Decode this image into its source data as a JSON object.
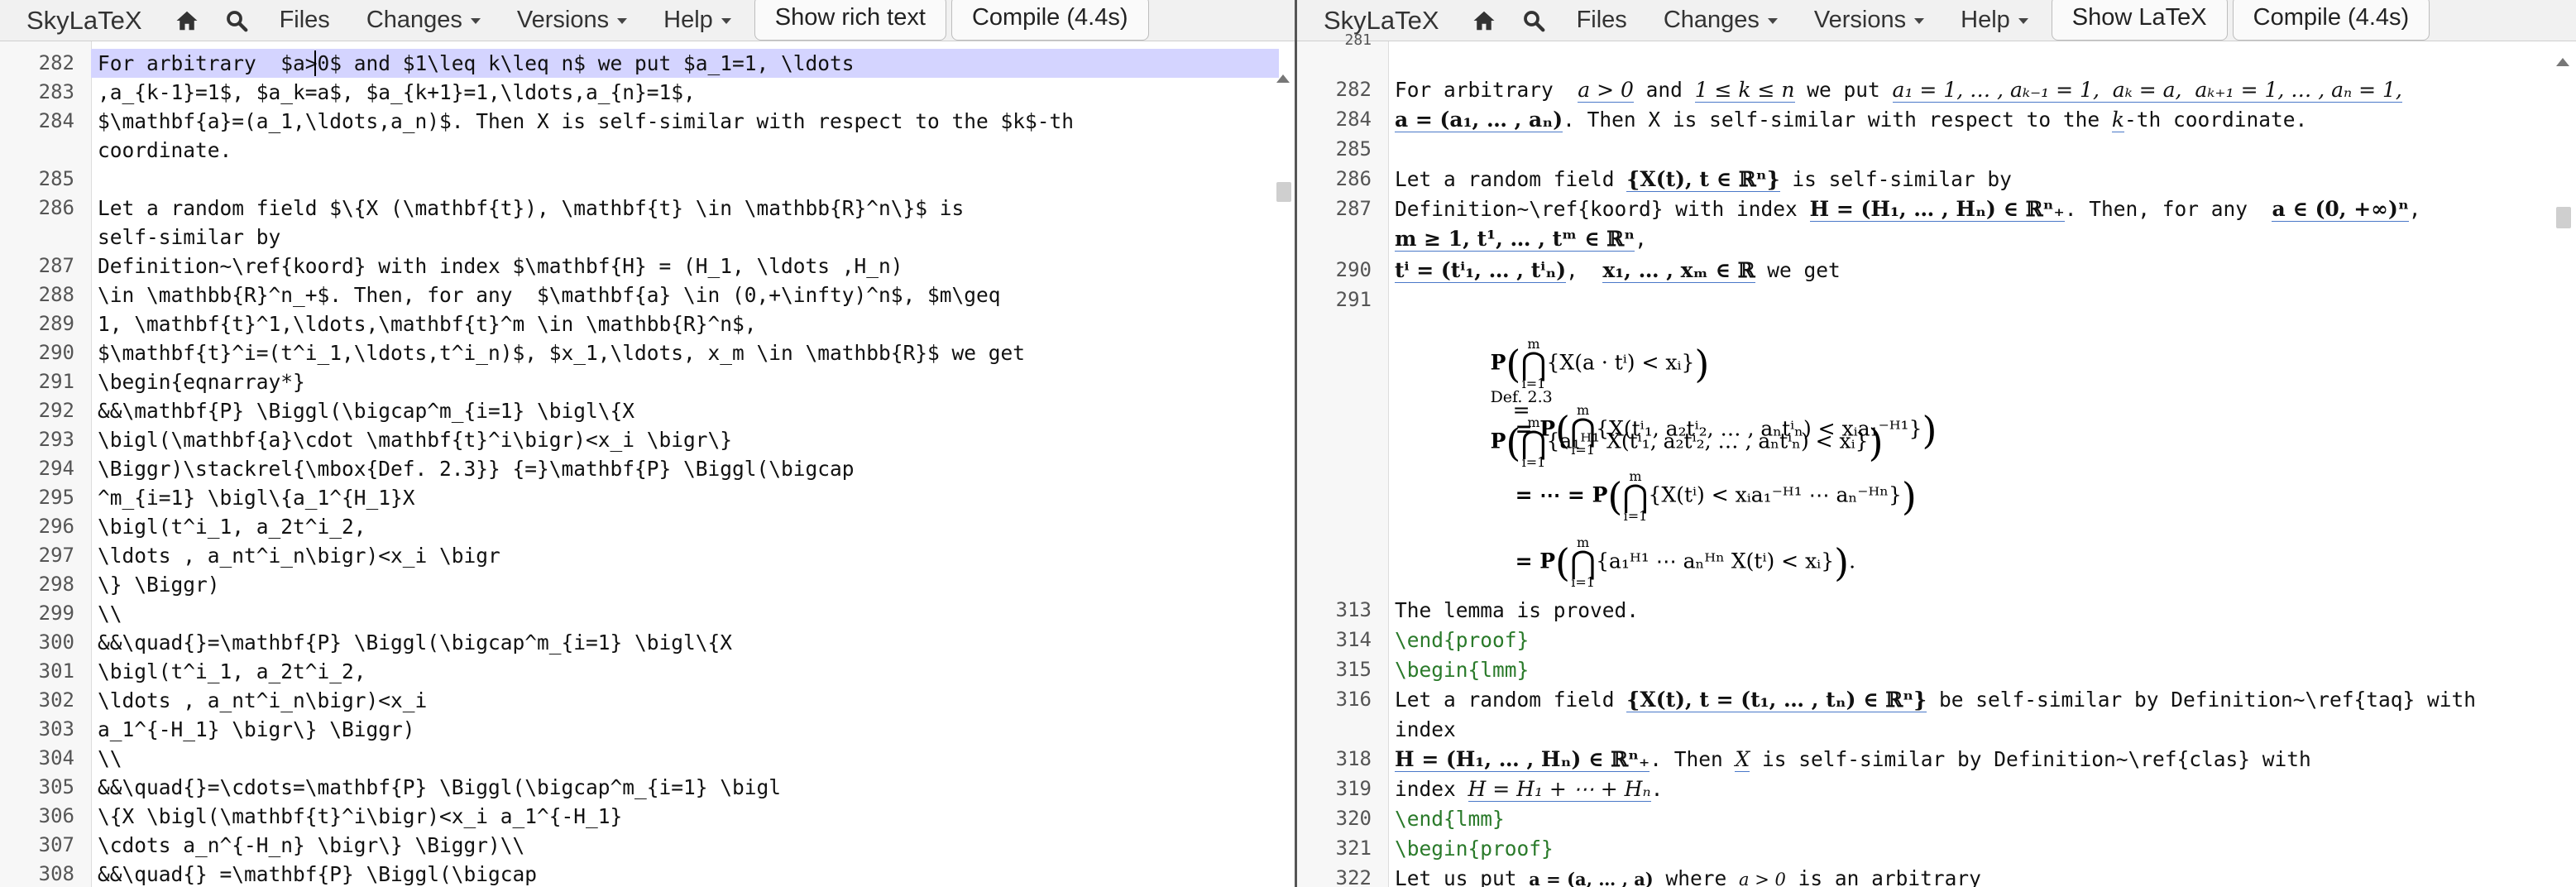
{
  "left": {
    "brand": "SkyLaTeX",
    "menu": {
      "files": "Files",
      "changes": "Changes",
      "versions": "Versions",
      "help": "Help"
    },
    "buttons": {
      "toggle": "Show rich text",
      "compile": "Compile (4.4s)"
    },
    "lines": [
      {
        "n": "282",
        "t": "For arbitrary  $a>0$ and $1\\leq k\\leq n$ we put $a_1=1, \\ldots"
      },
      {
        "n": "283",
        "t": ",a_{k-1}=1$, $a_k=a$, $a_{k+1}=1,\\ldots,a_{n}=1$,"
      },
      {
        "n": "284",
        "t": "$\\mathbf{a}=(a_1,\\ldots,a_n)$. Then X is self-similar with respect to the $k$-th"
      },
      {
        "n": "",
        "t": "coordinate."
      },
      {
        "n": "285",
        "t": ""
      },
      {
        "n": "286",
        "t": "Let a random field $\\{X (\\mathbf{t}), \\mathbf{t} \\in \\mathbb{R}^n\\}$ is"
      },
      {
        "n": "",
        "t": "self-similar by"
      },
      {
        "n": "287",
        "t": "Definition~\\ref{koord} with index $\\mathbf{H} = (H_1, \\ldots ,H_n)"
      },
      {
        "n": "288",
        "t": "\\in \\mathbb{R}^n_+$. Then, for any  $\\mathbf{a} \\in (0,+\\infty)^n$, $m\\geq"
      },
      {
        "n": "289",
        "t": "1, \\mathbf{t}^1,\\ldots,\\mathbf{t}^m \\in \\mathbb{R}^n$,"
      },
      {
        "n": "290",
        "t": "$\\mathbf{t}^i=(t^i_1,\\ldots,t^i_n)$, $x_1,\\ldots, x_m \\in \\mathbb{R}$ we get"
      },
      {
        "n": "291",
        "t": "\\begin{eqnarray*}"
      },
      {
        "n": "292",
        "t": "&&\\mathbf{P} \\Biggl(\\bigcap^m_{i=1} \\bigl\\{X"
      },
      {
        "n": "293",
        "t": "\\bigl(\\mathbf{a}\\cdot \\mathbf{t}^i\\bigr)<x_i \\bigr\\}"
      },
      {
        "n": "294",
        "t": "\\Biggr)\\stackrel{\\mbox{Def. 2.3}} {=}\\mathbf{P} \\Biggl(\\bigcap"
      },
      {
        "n": "295",
        "t": "^m_{i=1} \\bigl\\{a_1^{H_1}X"
      },
      {
        "n": "296",
        "t": "\\bigl(t^i_1, a_2t^i_2,"
      },
      {
        "n": "297",
        "t": "\\ldots , a_nt^i_n\\bigr)<x_i \\bigr"
      },
      {
        "n": "298",
        "t": "\\} \\Biggr)"
      },
      {
        "n": "299",
        "t": "\\\\"
      },
      {
        "n": "300",
        "t": "&&\\quad{}=\\mathbf{P} \\Biggl(\\bigcap^m_{i=1} \\bigl\\{X"
      },
      {
        "n": "301",
        "t": "\\bigl(t^i_1, a_2t^i_2,"
      },
      {
        "n": "302",
        "t": "\\ldots , a_nt^i_n\\bigr)<x_i"
      },
      {
        "n": "303",
        "t": "a_1^{-H_1} \\bigr\\} \\Biggr)"
      },
      {
        "n": "304",
        "t": "\\\\"
      },
      {
        "n": "305",
        "t": "&&\\quad{}=\\cdots=\\mathbf{P} \\Biggl(\\bigcap^m_{i=1} \\bigl"
      },
      {
        "n": "306",
        "t": "\\{X \\bigl(\\mathbf{t}^i\\bigr)<x_i a_1^{-H_1}"
      },
      {
        "n": "307",
        "t": "\\cdots a_n^{-H_n} \\bigr\\} \\Biggr)\\\\"
      },
      {
        "n": "308",
        "t": "&&\\quad{} =\\mathbf{P} \\Biggl(\\bigcap"
      }
    ]
  },
  "right": {
    "brand": "SkyLaTeX",
    "menu": {
      "files": "Files",
      "changes": "Changes",
      "versions": "Versions",
      "help": "Help"
    },
    "buttons": {
      "toggle": "Show LaTeX",
      "compile": "Compile (4.4s)"
    },
    "numbers": [
      "281",
      "282",
      "284",
      "285",
      "286",
      "287",
      "290",
      "291",
      "313",
      "314",
      "315",
      "316",
      "318",
      "319",
      "320",
      "321",
      "322"
    ],
    "text": {
      "l282_a": "For arbitrary  ",
      "l282_m1": "a > 0",
      "l282_b": " and ",
      "l282_m2": "1 ≤ k ≤ n",
      "l282_c": " we put ",
      "l282_m3": "a₁ = 1, … , aₖ₋₁ = 1,  aₖ = a,  aₖ₊₁ = 1, … , aₙ = 1,",
      "l284_m": "a = (a₁, … , aₙ)",
      "l284_b": ". Then X is self-similar with respect to the ",
      "l284_k": "k",
      "l284_c": "-th coordinate.",
      "l286_a": "Let a random field ",
      "l286_m": "{X(t), t ∈ ℝⁿ}",
      "l286_b": " is self-similar by",
      "l287_a": "Definition~\\ref{koord} with index ",
      "l287_m": "H = (H₁, … , Hₙ) ∈ ℝⁿ₊",
      "l287_b": ". Then, for any  ",
      "l287_m2": "a ∈ (0, +∞)ⁿ",
      "l287_c": ",",
      "l288_m": "m ≥ 1, t¹, … , tᵐ ∈ ℝⁿ",
      "l288_c": ",",
      "l290_m": "tⁱ = (tⁱ₁, … , tⁱₙ)",
      "l290_b": ",  ",
      "l290_m2": "x₁, … , xₘ ∈ ℝ",
      "l290_c": " we get",
      "eq1_a": "P",
      "eq1_b": "{X(a · tⁱ) < xᵢ}",
      "eq1_def": "Def. 2.3",
      "eq1_c": "P",
      "eq1_d": "{a₁ᴴ¹ X(tⁱ₁, a₂tⁱ₂, … , aₙtⁱₙ) < xᵢ}",
      "eq2": "= P",
      "eq2_b": "{X(tⁱ₁, a₂tⁱ₂, … , aₙtⁱₙ) < xᵢa₁⁻ᴴ¹}",
      "eq3": "= ⋯ = P",
      "eq3_b": "{X(tⁱ) < xᵢa₁⁻ᴴ¹ ⋯ aₙ⁻ᴴⁿ}",
      "eq4": "= P",
      "eq4_b": "{a₁ᴴ¹ ⋯ aₙᴴⁿ X(tⁱ) < xᵢ}",
      "eq4_c": ".",
      "cap": "⋂",
      "cap_top": "m",
      "cap_bot": "i=1",
      "l313": "The lemma is proved.",
      "l314": "\\end{proof}",
      "l315": "\\begin{lmm}",
      "l316_a": "Let a random field ",
      "l316_m": "{X(t), t = (t₁, … , tₙ) ∈ ℝⁿ}",
      "l316_b": " be self-similar by Definition~\\ref{taq} with",
      "l316_c": "index",
      "l318_m": "H = (H₁, … , Hₙ) ∈ ℝⁿ₊",
      "l318_b": ". Then ",
      "l318_x": "X",
      "l318_c": " is self-similar by Definition~\\ref{clas} with",
      "l319_a": "index ",
      "l319_m": "H = H₁ + ⋯ + Hₙ",
      "l319_b": ".",
      "l320": "\\end{lmm}",
      "l321": "\\begin{proof}",
      "l322_a": "Let us put ",
      "l322_m": "a = (a, … , a)",
      "l322_b": " where ",
      "l322_m2": "a > 0",
      "l322_c": " is an arbitrary"
    }
  }
}
